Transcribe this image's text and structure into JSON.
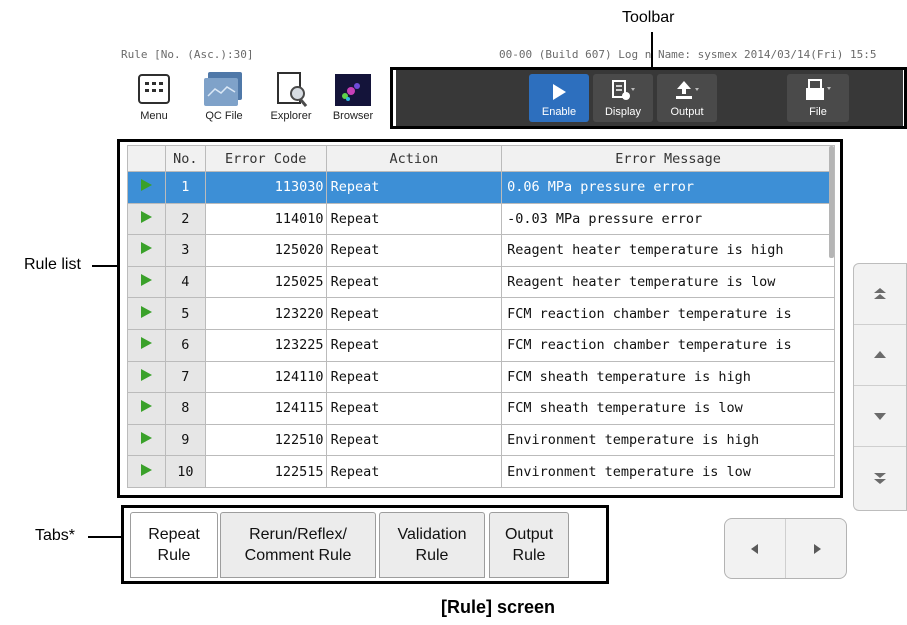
{
  "annotations": {
    "toolbar": "Toolbar",
    "rule_list": "Rule list",
    "tabs": "Tabs*",
    "caption": "[Rule] screen"
  },
  "status": {
    "left": "Rule [No. (Asc.):30]",
    "right": "00-00 (Build 607)  Log n Name: sysmex  2014/03/14(Fri) 15:5"
  },
  "launchers": [
    {
      "label": "Menu",
      "icon": "menu-grid-icon"
    },
    {
      "label": "QC File",
      "icon": "qc-file-icon"
    },
    {
      "label": "Explorer",
      "icon": "explorer-icon"
    },
    {
      "label": "Browser",
      "icon": "browser-icon"
    }
  ],
  "toolbar": {
    "enable": "Enable",
    "display": "Display",
    "output": "Output",
    "file": "File"
  },
  "table": {
    "headers": [
      "No.",
      "Error Code",
      "Action",
      "Error Message"
    ],
    "rows": [
      {
        "no": "1",
        "code": "113030",
        "action": "Repeat",
        "message": "0.06 MPa pressure error",
        "selected": true
      },
      {
        "no": "2",
        "code": "114010",
        "action": "Repeat",
        "message": "-0.03 MPa pressure error"
      },
      {
        "no": "3",
        "code": "125020",
        "action": "Repeat",
        "message": "Reagent heater temperature is high"
      },
      {
        "no": "4",
        "code": "125025",
        "action": "Repeat",
        "message": "Reagent heater temperature is low"
      },
      {
        "no": "5",
        "code": "123220",
        "action": "Repeat",
        "message": "FCM reaction chamber temperature is"
      },
      {
        "no": "6",
        "code": "123225",
        "action": "Repeat",
        "message": "FCM reaction chamber temperature is"
      },
      {
        "no": "7",
        "code": "124110",
        "action": "Repeat",
        "message": "FCM sheath temperature is high"
      },
      {
        "no": "8",
        "code": "124115",
        "action": "Repeat",
        "message": "FCM sheath temperature is low"
      },
      {
        "no": "9",
        "code": "122510",
        "action": "Repeat",
        "message": "Environment temperature is high"
      },
      {
        "no": "10",
        "code": "122515",
        "action": "Repeat",
        "message": "Environment temperature is low"
      }
    ]
  },
  "tabs": [
    {
      "line1": "Repeat",
      "line2": "Rule"
    },
    {
      "line1": "Rerun/Reflex/",
      "line2": "Comment Rule"
    },
    {
      "line1": "Validation",
      "line2": "Rule"
    },
    {
      "line1": "Output",
      "line2": "Rule"
    }
  ]
}
